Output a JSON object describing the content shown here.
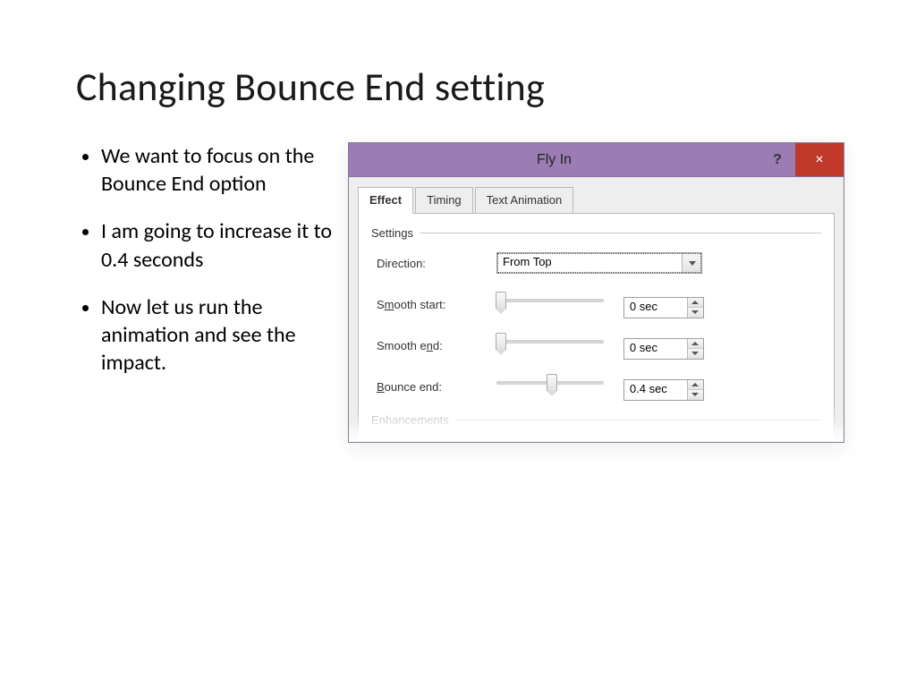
{
  "slide": {
    "title": "Changing Bounce End setting",
    "bullets": [
      "We want to focus on the Bounce End option",
      "I am going to increase it to 0.4 seconds",
      "Now let us run the animation and see the impact."
    ]
  },
  "dialog": {
    "title": "Fly In",
    "help": "?",
    "close": "×",
    "tabs": [
      "Effect",
      "Timing",
      "Text Animation"
    ],
    "active_tab": 0,
    "group_settings": "Settings",
    "group_enhancements": "Enhancements",
    "direction_label": "Direction:",
    "direction_value": "From Top",
    "rows": [
      {
        "key": "smooth_start",
        "label_pre": "S",
        "label_u": "m",
        "label_post": "ooth start:",
        "value": "0 sec",
        "slider_pct": 4
      },
      {
        "key": "smooth_end",
        "label_pre": "Smooth e",
        "label_u": "n",
        "label_post": "d:",
        "value": "0 sec",
        "slider_pct": 4
      },
      {
        "key": "bounce_end",
        "label_pre": "",
        "label_u": "B",
        "label_post": "ounce end:",
        "value": "0.4 sec",
        "slider_pct": 52
      }
    ]
  }
}
